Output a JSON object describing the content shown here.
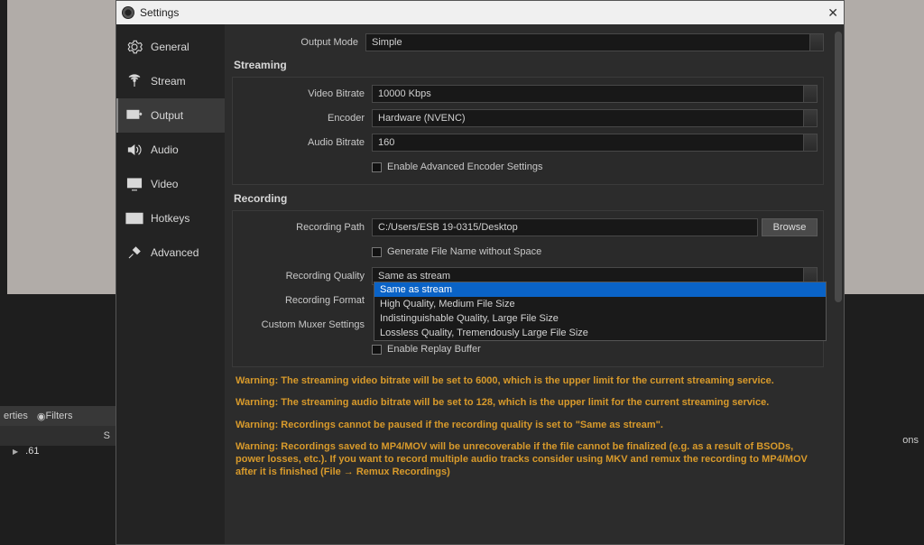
{
  "backdrop": {
    "tab_properties": "erties",
    "tab_filters": "Filters",
    "label_s": "S",
    "item61": ".61",
    "ons": "ons"
  },
  "dialog": {
    "title": "Settings"
  },
  "sidebar": {
    "items": [
      {
        "label": "General"
      },
      {
        "label": "Stream"
      },
      {
        "label": "Output"
      },
      {
        "label": "Audio"
      },
      {
        "label": "Video"
      },
      {
        "label": "Hotkeys"
      },
      {
        "label": "Advanced"
      }
    ]
  },
  "output": {
    "mode_label": "Output Mode",
    "mode_value": "Simple",
    "streaming": {
      "title": "Streaming",
      "video_bitrate_label": "Video Bitrate",
      "video_bitrate_value": "10000 Kbps",
      "encoder_label": "Encoder",
      "encoder_value": "Hardware (NVENC)",
      "audio_bitrate_label": "Audio Bitrate",
      "audio_bitrate_value": "160",
      "enable_advanced": "Enable Advanced Encoder Settings"
    },
    "recording": {
      "title": "Recording",
      "path_label": "Recording Path",
      "path_value": "C:/Users/ESB 19-0315/Desktop",
      "browse": "Browse",
      "gen_no_space": "Generate File Name without Space",
      "quality_label": "Recording Quality",
      "quality_value": "Same as stream",
      "quality_options": [
        "Same as stream",
        "High Quality, Medium File Size",
        "Indistinguishable Quality, Large File Size",
        "Lossless Quality, Tremendously Large File Size"
      ],
      "format_label": "Recording Format",
      "muxer_label": "Custom Muxer Settings",
      "enable_replay": "Enable Replay Buffer"
    },
    "warnings": [
      "Warning: The streaming video bitrate will be set to 6000, which is the upper limit for the current streaming service.",
      "Warning: The streaming audio bitrate will be set to 128, which is the upper limit for the current streaming service.",
      "Warning: Recordings cannot be paused if the recording quality is set to \"Same as stream\".",
      "Warning: Recordings saved to MP4/MOV will be unrecoverable if the file cannot be finalized (e.g. as a result of BSODs, power losses, etc.). If you want to record multiple audio tracks consider using MKV and remux the recording to MP4/MOV after it is finished (File → Remux Recordings)"
    ]
  }
}
